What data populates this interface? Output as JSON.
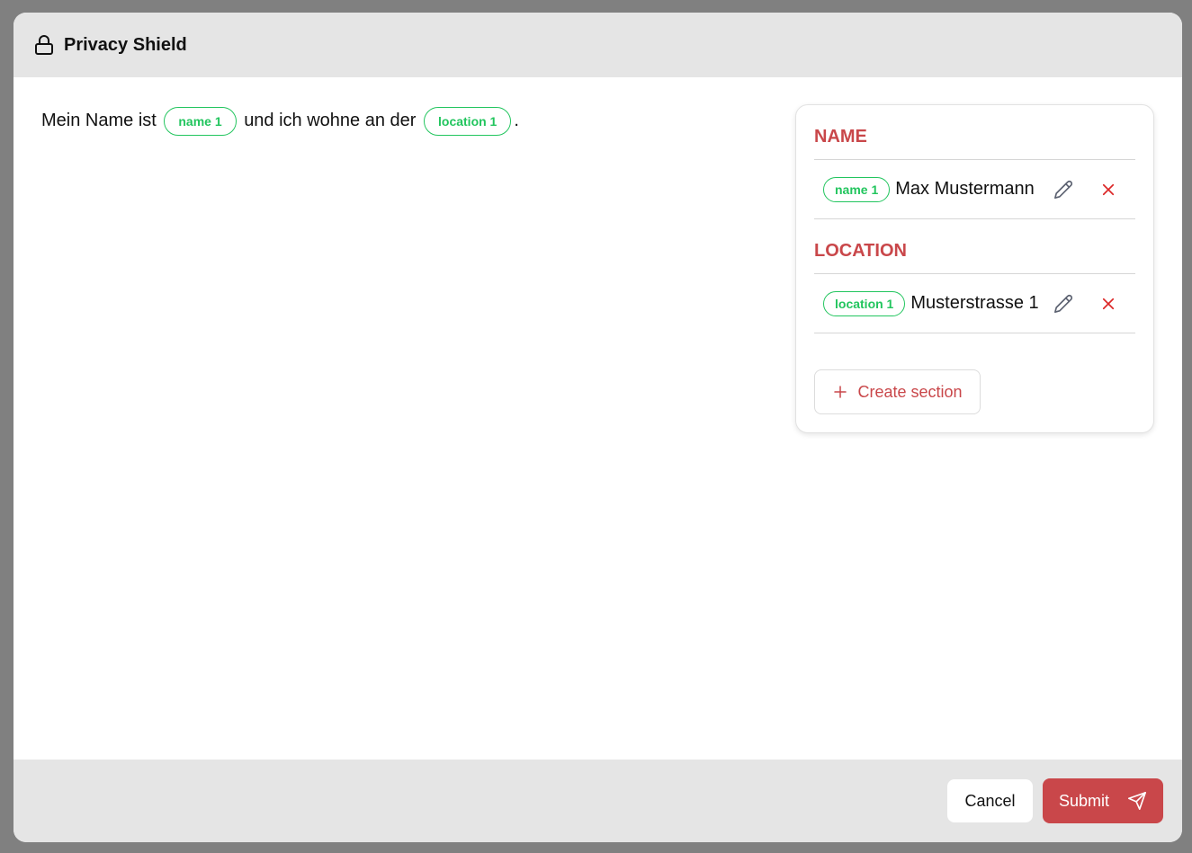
{
  "header": {
    "title": "Privacy Shield",
    "icon": "lock-icon"
  },
  "preview": {
    "segments": {
      "s0": "Mein Name ist",
      "tag1": "name 1",
      "s1": "und ich wohne an der",
      "tag2": "location 1",
      "s2": "."
    }
  },
  "panel": {
    "sections": [
      {
        "heading": "NAME",
        "entries": [
          {
            "tag": "name 1",
            "value": "Max Mustermann"
          }
        ]
      },
      {
        "heading": "LOCATION",
        "entries": [
          {
            "tag": "location 1",
            "value": "Musterstrasse 1"
          }
        ]
      }
    ],
    "create_label": "Create section"
  },
  "footer": {
    "cancel_label": "Cancel",
    "submit_label": "Submit"
  },
  "colors": {
    "accent": "#c9474a",
    "tag": "#22c55e",
    "header_bg": "#e5e5e5",
    "backdrop": "#808080"
  }
}
